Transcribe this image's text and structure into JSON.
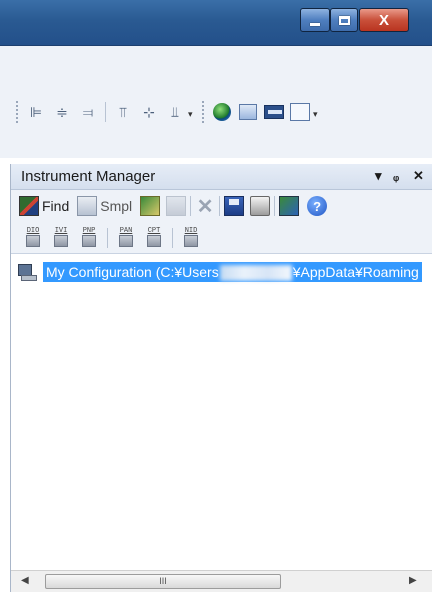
{
  "window": {
    "min_label": "",
    "max_label": "",
    "close_label": "X"
  },
  "pane": {
    "title": "Instrument Manager",
    "pin_glyph": "▾",
    "dock_glyph": "ᵱ",
    "close_glyph": "✕"
  },
  "toolbar": {
    "find_label": "Find",
    "smpl_label": "Smpl",
    "help_glyph": "?"
  },
  "protocols": [
    "DIO",
    "IVI",
    "PNP",
    "PAN",
    "CPT",
    "NID"
  ],
  "tree": {
    "item_prefix": "My Configuration (C:¥Users",
    "item_suffix": "¥AppData¥Roaming"
  },
  "scroll": {
    "thumb_grip": "III",
    "left_arrow": "◀",
    "right_arrow": "▶"
  }
}
